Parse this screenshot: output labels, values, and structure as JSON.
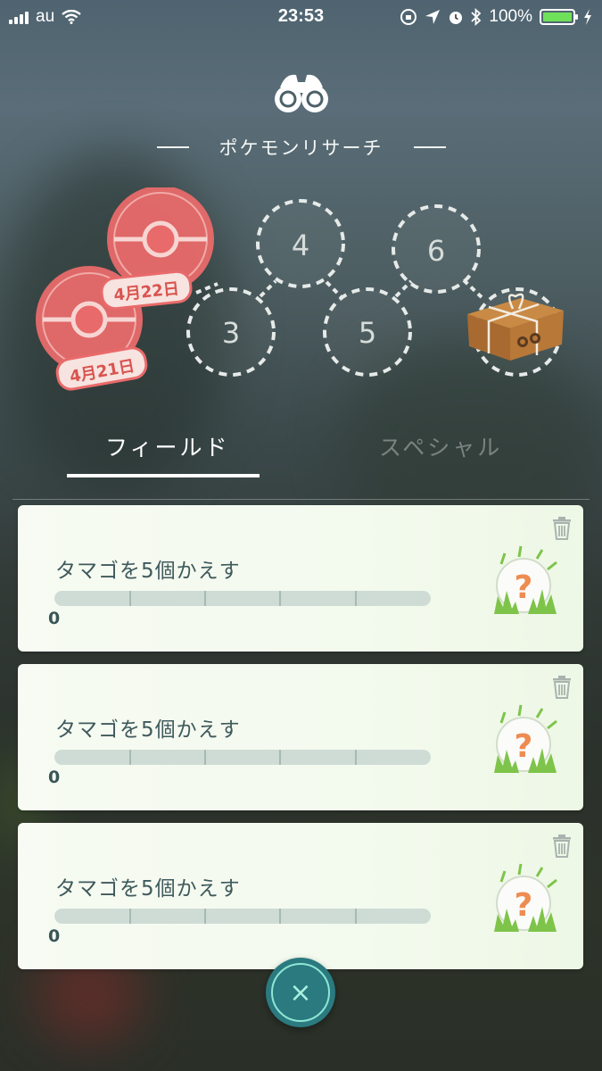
{
  "status_bar": {
    "carrier": "au",
    "time": "23:53",
    "battery": "100%",
    "battery_color": "#6fe05a"
  },
  "header": {
    "icon": "binoculars-icon",
    "title": "ポケモンリサーチ"
  },
  "research_path": {
    "stamps": [
      {
        "date": "4月22日"
      },
      {
        "date": "4月21日"
      }
    ],
    "slots": [
      "3",
      "4",
      "5",
      "6"
    ],
    "reward_icon": "reward-box-icon",
    "stamp_color": "#e96a6a"
  },
  "tabs": [
    {
      "label": "フィールド",
      "active": true
    },
    {
      "label": "スペシャル",
      "active": false
    }
  ],
  "quests": [
    {
      "text": "タマゴを5個かえす",
      "progress": 0,
      "goal": 5,
      "progress_label": "0"
    },
    {
      "text": "タマゴを5個かえす",
      "progress": 0,
      "goal": 5,
      "progress_label": "0"
    },
    {
      "text": "タマゴを5個かえす",
      "progress": 0,
      "goal": 5,
      "progress_label": "0"
    }
  ],
  "close": {
    "glyph": "×"
  }
}
